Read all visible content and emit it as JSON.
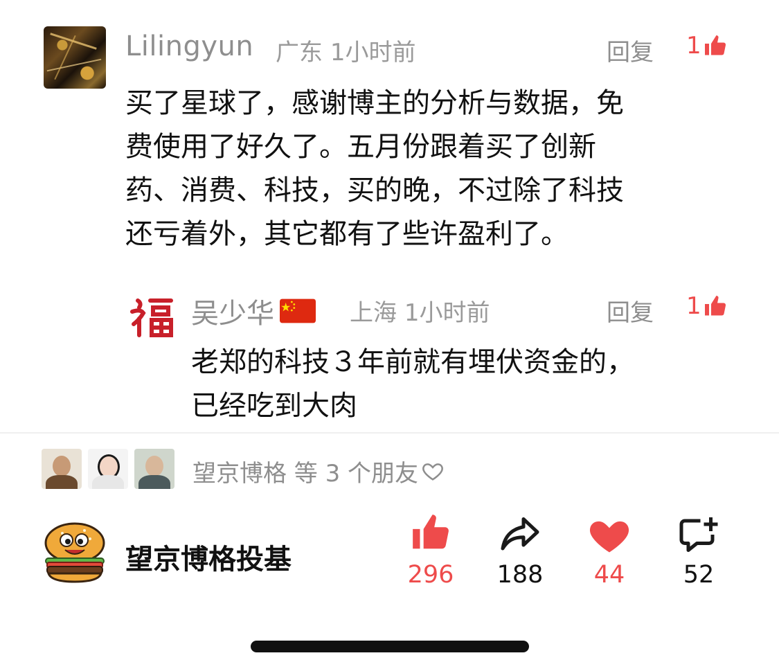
{
  "comment": {
    "author": "Lilingyun",
    "location": "广东",
    "time": "1小时前",
    "reply_label": "回复",
    "likes": "1",
    "text": "买了星球了，感谢博主的分析与数据，免\n费使用了好久了。五月份跟着买了创新\n药、消费、科技，买的晚，不过除了科技\n还亏着外，其它都有了些许盈利了。"
  },
  "reply": {
    "author": "吴少华",
    "location": "上海",
    "time": "1小时前",
    "reply_label": "回复",
    "likes": "1",
    "text": "老郑的科技３年前就有埋伏资金的，\n已经吃到大肉"
  },
  "friends": {
    "text": "望京博格 等 3 个朋友"
  },
  "author_bar": {
    "name": "望京博格投基",
    "likes": "296",
    "shares": "188",
    "hearts": "44",
    "comments": "52"
  },
  "colors": {
    "accent": "#ee4b4b",
    "meta_gray": "#9a9a9a"
  },
  "icons": [
    "thumb-up-icon",
    "share-icon",
    "heart-icon",
    "comment-add-icon",
    "heart-outline-icon",
    "china-flag-icon",
    "fu-character-icon",
    "burger-avatar-icon"
  ]
}
